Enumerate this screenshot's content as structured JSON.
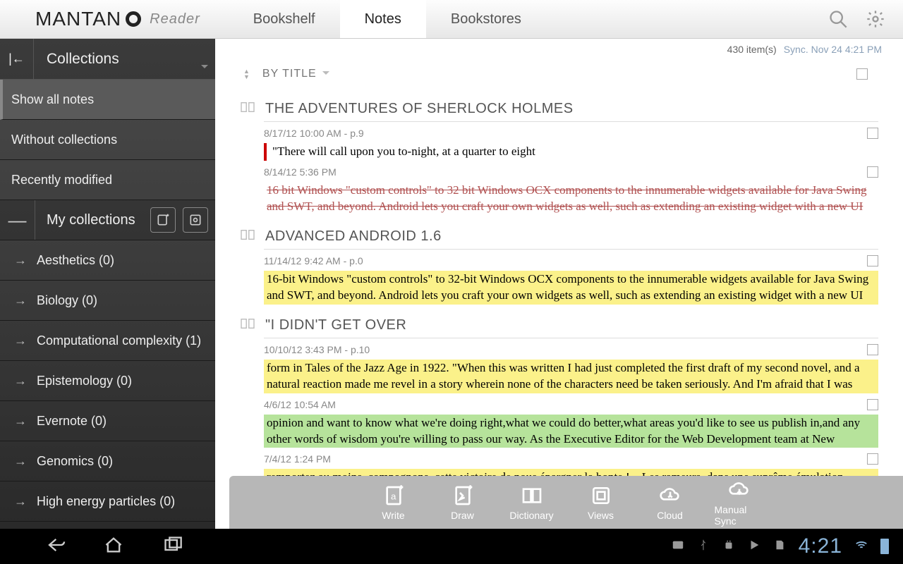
{
  "app": {
    "brand1": "MANTAN",
    "brand2": "Reader"
  },
  "header": {
    "tabs": [
      "Bookshelf",
      "Notes",
      "Bookstores"
    ],
    "active_tab": 1
  },
  "sidebar": {
    "title": "Collections",
    "filters": [
      "Show all notes",
      "Without collections",
      "Recently modified"
    ],
    "selected_filter": 0,
    "my_collections_label": "My collections",
    "collections": [
      "Aesthetics (0)",
      "Biology (0)",
      "Computational complexity (1)",
      "Epistemology (0)",
      "Evernote (0)",
      "Genomics (0)",
      "High energy particles (0)"
    ]
  },
  "main": {
    "item_count": "430 item(s)",
    "sync_text": "Sync. Nov 24 4:21 PM",
    "sort_label": "BY TITLE",
    "books": [
      {
        "title": "THE ADVENTURES OF SHERLOCK HOLMES",
        "notes": [
          {
            "meta": "8/17/12 10:00 AM   -   p.9",
            "style": "red-bar",
            "text": "\"There will call upon you to-night, at a quarter to eight"
          },
          {
            "meta": "8/14/12 5:36 PM",
            "style": "strike",
            "text": "16 bit Windows \"custom controls\" to 32 bit Windows OCX components to the innumerable widgets available for Java Swing and SWT, and beyond. Android lets you craft your own widgets as well, such as extending an existing widget with a new UI"
          }
        ]
      },
      {
        "title": "ADVANCED ANDROID 1.6",
        "notes": [
          {
            "meta": "11/14/12 9:42 AM   -   p.0",
            "style": "hl-yellow",
            "text": "16-bit Windows \"custom controls\" to 32-bit Windows OCX components to the innumerable widgets available for Java Swing and SWT, and beyond. Android lets you craft your own widgets as well, such as extending an existing widget with a new UI"
          }
        ]
      },
      {
        "title": "\"I DIDN'T GET OVER",
        "notes": [
          {
            "meta": "10/10/12 3:43 PM   -   p.10",
            "style": "hl-yellow",
            "text": "form in Tales of the Jazz Age in 1922. \"When this was written I had just completed the first draft of my second novel, and a natural reaction made me revel in a story wherein none of the characters need be taken seriously. And I'm afraid that I was"
          },
          {
            "meta": "4/6/12 10:54 AM",
            "style": "hl-green",
            "text": "opinion and want to know what we're doing right,what we could do better,what areas you'd like to see us publish in,and any other words of wisdom you're willing to pass our way. As the Executive Editor for the Web Development team at New"
          },
          {
            "meta": "7/4/12 1:24 PM",
            "style": "hl-yellow",
            "text": "remportez au moins, compagnons, cette victoire de nous épargner la honte ! » Les rameurs, dans une suprême émulation,"
          }
        ]
      }
    ]
  },
  "toolbar": {
    "buttons": [
      "Write",
      "Draw",
      "Dictionary",
      "Views",
      "Cloud",
      "Manual Sync"
    ]
  },
  "sysbar": {
    "clock": "4:21"
  }
}
